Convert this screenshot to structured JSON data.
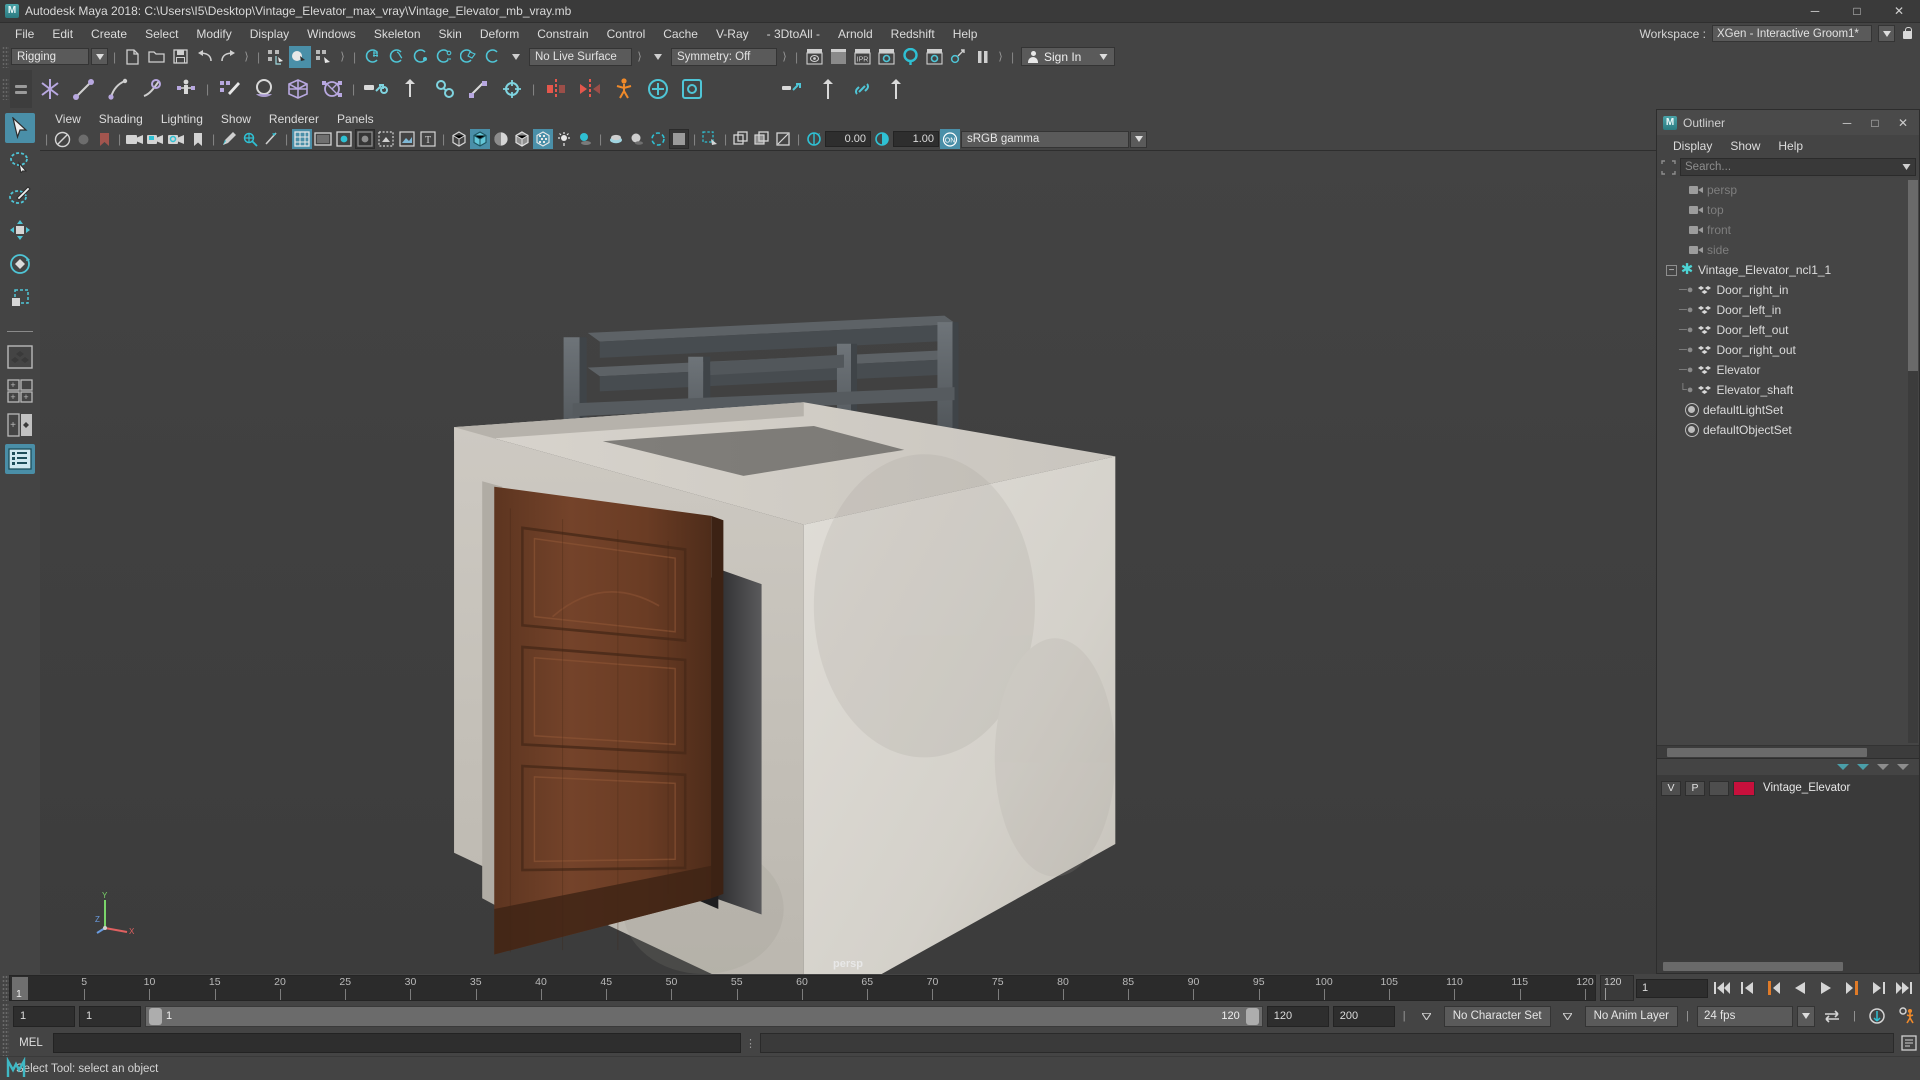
{
  "titlebar": {
    "app_title": "Autodesk Maya 2018: C:\\Users\\I5\\Desktop\\Vintage_Elevator_max_vray\\Vintage_Elevator_mb_vray.mb",
    "minimize": "─",
    "maximize": "□",
    "close": "✕"
  },
  "menubar": {
    "items": [
      {
        "label": "File"
      },
      {
        "label": "Edit"
      },
      {
        "label": "Create"
      },
      {
        "label": "Select"
      },
      {
        "label": "Modify"
      },
      {
        "label": "Display"
      },
      {
        "label": "Windows"
      },
      {
        "label": "Skeleton"
      },
      {
        "label": "Skin"
      },
      {
        "label": "Deform"
      },
      {
        "label": "Constrain"
      },
      {
        "label": "Control"
      },
      {
        "label": "Cache"
      },
      {
        "label": "V-Ray"
      },
      {
        "label": "- 3DtoAll -"
      },
      {
        "label": "Arnold"
      },
      {
        "label": "Redshift"
      },
      {
        "label": "Help"
      }
    ],
    "workspace_label": "Workspace :",
    "workspace_value": "XGen - Interactive Groom1*"
  },
  "statusline": {
    "menu_set": "Rigging",
    "live_surface": "No Live Surface",
    "symmetry": "Symmetry: Off",
    "sign_in": "Sign In",
    "ipr_label": "IPR"
  },
  "viewport_panel": {
    "menus": [
      {
        "label": "View"
      },
      {
        "label": "Shading"
      },
      {
        "label": "Lighting"
      },
      {
        "label": "Show"
      },
      {
        "label": "Renderer"
      },
      {
        "label": "Panels"
      }
    ],
    "exposure": "0.00",
    "gamma_value": "1.00",
    "color_management": "sRGB gamma",
    "camera_label": "persp",
    "axis_labels": {
      "y": "Y",
      "x": "X",
      "z": "Z"
    }
  },
  "outliner": {
    "window_title": "Outliner",
    "menus": [
      {
        "label": "Display"
      },
      {
        "label": "Show"
      },
      {
        "label": "Help"
      }
    ],
    "search_placeholder": "Search...",
    "tree": [
      {
        "label": "persp",
        "icon": "camera-icon",
        "type": "camera",
        "dim": true,
        "indent": 1
      },
      {
        "label": "top",
        "icon": "camera-icon",
        "type": "camera",
        "dim": true,
        "indent": 1
      },
      {
        "label": "front",
        "icon": "camera-icon",
        "type": "camera",
        "dim": true,
        "indent": 1
      },
      {
        "label": "side",
        "icon": "camera-icon",
        "type": "camera",
        "dim": true,
        "indent": 1
      },
      {
        "label": "Vintage_Elevator_ncl1_1",
        "icon": "group-star-icon",
        "type": "group",
        "dim": false,
        "indent": 0,
        "expanded": true
      },
      {
        "label": "Door_right_in",
        "icon": "mesh-icon",
        "type": "mesh",
        "dim": false,
        "indent": 1
      },
      {
        "label": "Door_left_in",
        "icon": "mesh-icon",
        "type": "mesh",
        "dim": false,
        "indent": 1
      },
      {
        "label": "Door_left_out",
        "icon": "mesh-icon",
        "type": "mesh",
        "dim": false,
        "indent": 1
      },
      {
        "label": "Door_right_out",
        "icon": "mesh-icon",
        "type": "mesh",
        "dim": false,
        "indent": 1
      },
      {
        "label": "Elevator",
        "icon": "mesh-icon",
        "type": "mesh",
        "dim": false,
        "indent": 1
      },
      {
        "label": "Elevator_shaft",
        "icon": "mesh-icon",
        "type": "mesh",
        "dim": false,
        "indent": 1
      },
      {
        "label": "defaultLightSet",
        "icon": "set-icon",
        "type": "set",
        "dim": false,
        "indent": 1
      },
      {
        "label": "defaultObjectSet",
        "icon": "set-icon",
        "type": "set",
        "dim": false,
        "indent": 1
      }
    ]
  },
  "layer_editor": {
    "visibility_toggle": "V",
    "playback_toggle": "P",
    "layer_name": "Vintage_Elevator",
    "layer_color": "#c8103c"
  },
  "time_slider": {
    "current_frame": "1",
    "end_display": "120",
    "frame_input": "1",
    "ticks": [
      {
        "label": "5",
        "value": 5
      },
      {
        "label": "10",
        "value": 10
      },
      {
        "label": "15",
        "value": 15
      },
      {
        "label": "20",
        "value": 20
      },
      {
        "label": "25",
        "value": 25
      },
      {
        "label": "30",
        "value": 30
      },
      {
        "label": "35",
        "value": 35
      },
      {
        "label": "40",
        "value": 40
      },
      {
        "label": "45",
        "value": 45
      },
      {
        "label": "50",
        "value": 50
      },
      {
        "label": "55",
        "value": 55
      },
      {
        "label": "60",
        "value": 60
      },
      {
        "label": "65",
        "value": 65
      },
      {
        "label": "70",
        "value": 70
      },
      {
        "label": "75",
        "value": 75
      },
      {
        "label": "80",
        "value": 80
      },
      {
        "label": "85",
        "value": 85
      },
      {
        "label": "90",
        "value": 90
      },
      {
        "label": "95",
        "value": 95
      },
      {
        "label": "100",
        "value": 100
      },
      {
        "label": "105",
        "value": 105
      },
      {
        "label": "110",
        "value": 110
      },
      {
        "label": "115",
        "value": 115
      },
      {
        "label": "120",
        "value": 120
      }
    ],
    "range_min": 1,
    "range_max": 120
  },
  "range_slider": {
    "anim_start": "1",
    "range_start": "1",
    "slider_start_label": "1",
    "slider_end_label": "120",
    "range_end": "120",
    "anim_end": "200",
    "character_set": "No Character Set",
    "anim_layer": "No Anim Layer",
    "fps": "24 fps"
  },
  "command_line": {
    "language": "MEL",
    "input_value": "",
    "output_value": ""
  },
  "status_bar": {
    "help_text": "Select Tool: select an object"
  },
  "colors": {
    "accent_teal": "#4a9ea8",
    "active_blue": "#4a8fa8",
    "panel_bg": "#444444",
    "viewport_bg": "#3f3f3f",
    "orange": "#e07b28"
  }
}
